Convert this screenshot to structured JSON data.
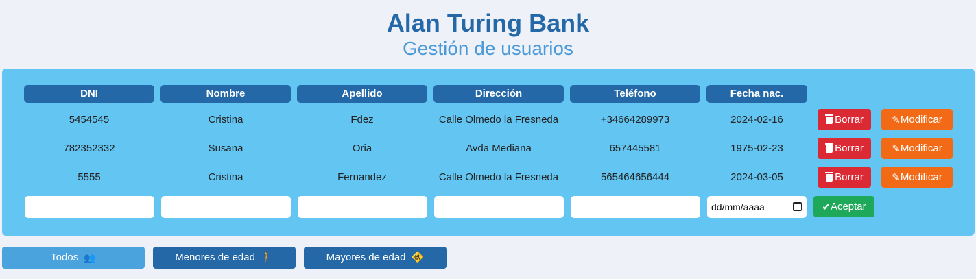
{
  "header": {
    "title": "Alan Turing Bank",
    "subtitle": "Gestión de usuarios"
  },
  "table": {
    "columns": [
      "DNI",
      "Nombre",
      "Apellido",
      "Dirección",
      "Teléfono",
      "Fecha nac."
    ],
    "rows": [
      {
        "dni": "5454545",
        "nombre": "Cristina",
        "apellido": "Fdez",
        "direccion": "Calle Olmedo la Fresneda",
        "telefono": "+34664289973",
        "fecha": "2024-02-16"
      },
      {
        "dni": "782352332",
        "nombre": "Susana",
        "apellido": "Oria",
        "direccion": "Avda Mediana",
        "telefono": "657445581",
        "fecha": "1975-02-23"
      },
      {
        "dni": "5555",
        "nombre": "Cristina",
        "apellido": "Fernandez",
        "direccion": "Calle Olmedo la Fresneda",
        "telefono": "565464656444",
        "fecha": "2024-03-05"
      }
    ],
    "delete_label": "Borrar",
    "modify_label": "Modificar"
  },
  "new_row": {
    "dni_value": "",
    "nombre_value": "",
    "apellido_value": "",
    "direccion_value": "",
    "telefono_value": "",
    "date_placeholder": "dd/mm/aaaa",
    "accept_label": "Aceptar"
  },
  "filters": {
    "all_label": "Todos",
    "minors_label": "Menores de edad",
    "adults_label": "Mayores de edad"
  },
  "colors": {
    "brand_dark": "#2468a8",
    "brand_light": "#4b9ad8",
    "panel": "#63c5f2",
    "delete": "#dc2a35",
    "modify": "#f26a16",
    "accept": "#1ea85a",
    "filter_active": "#4aa3dc"
  }
}
